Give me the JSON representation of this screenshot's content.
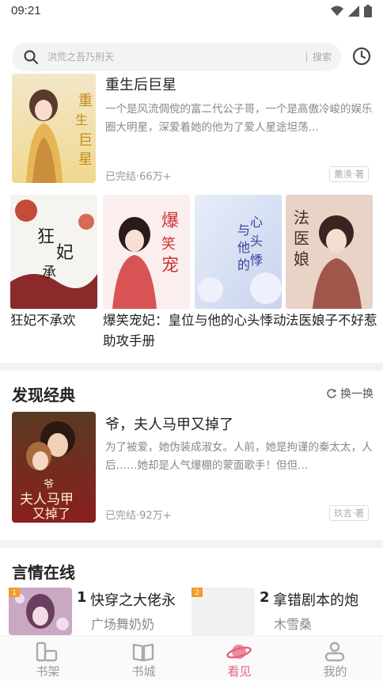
{
  "status_bar": {
    "time": "09:21"
  },
  "search": {
    "placeholder": "洪荒之吾乃刑天",
    "button_label": "搜索"
  },
  "featured_book": {
    "title": "重生后巨星",
    "description": "一个是风流倜傥的富二代公子哥，一个是高傲冷峻的娱乐圈大明星，深爱着她的他为了爱人星途坦荡…",
    "meta": "已完结·66万+",
    "author": "薰涣·著"
  },
  "grid_books": [
    {
      "title": "狂妃不承欢"
    },
    {
      "title": "爆笑宠妃：皇位助攻手册"
    },
    {
      "title": "与他的心头悸动"
    },
    {
      "title": "法医娘子不好惹"
    }
  ],
  "discover": {
    "section_title": "发现经典",
    "refresh_label": "换一换",
    "book": {
      "title": "爷，夫人马甲又掉了",
      "description": "为了被爱，她伪装成淑女。人前，她是拘谨的秦太太，人后……她却是人气爆棚的蒙面歌手！但但…",
      "meta": "已完结·92万+",
      "author": "玖言·著"
    }
  },
  "romance": {
    "section_title": "言情在线",
    "items": [
      {
        "rank": "1",
        "rank_label": "1",
        "title": "快穿之大佬永",
        "author": "广场舞奶奶"
      },
      {
        "rank": "2",
        "rank_label": "2",
        "title": "拿错剧本的炮",
        "author": "木雪桑"
      }
    ]
  },
  "bottom_nav": {
    "items": [
      {
        "label": "书架",
        "icon": "bookshelf-icon"
      },
      {
        "label": "书城",
        "icon": "book-city-icon"
      },
      {
        "label": "看见",
        "icon": "planet-icon",
        "active": true
      },
      {
        "label": "我的",
        "icon": "profile-icon"
      }
    ],
    "active_color": "#e8617a",
    "inactive_color": "#999999"
  }
}
